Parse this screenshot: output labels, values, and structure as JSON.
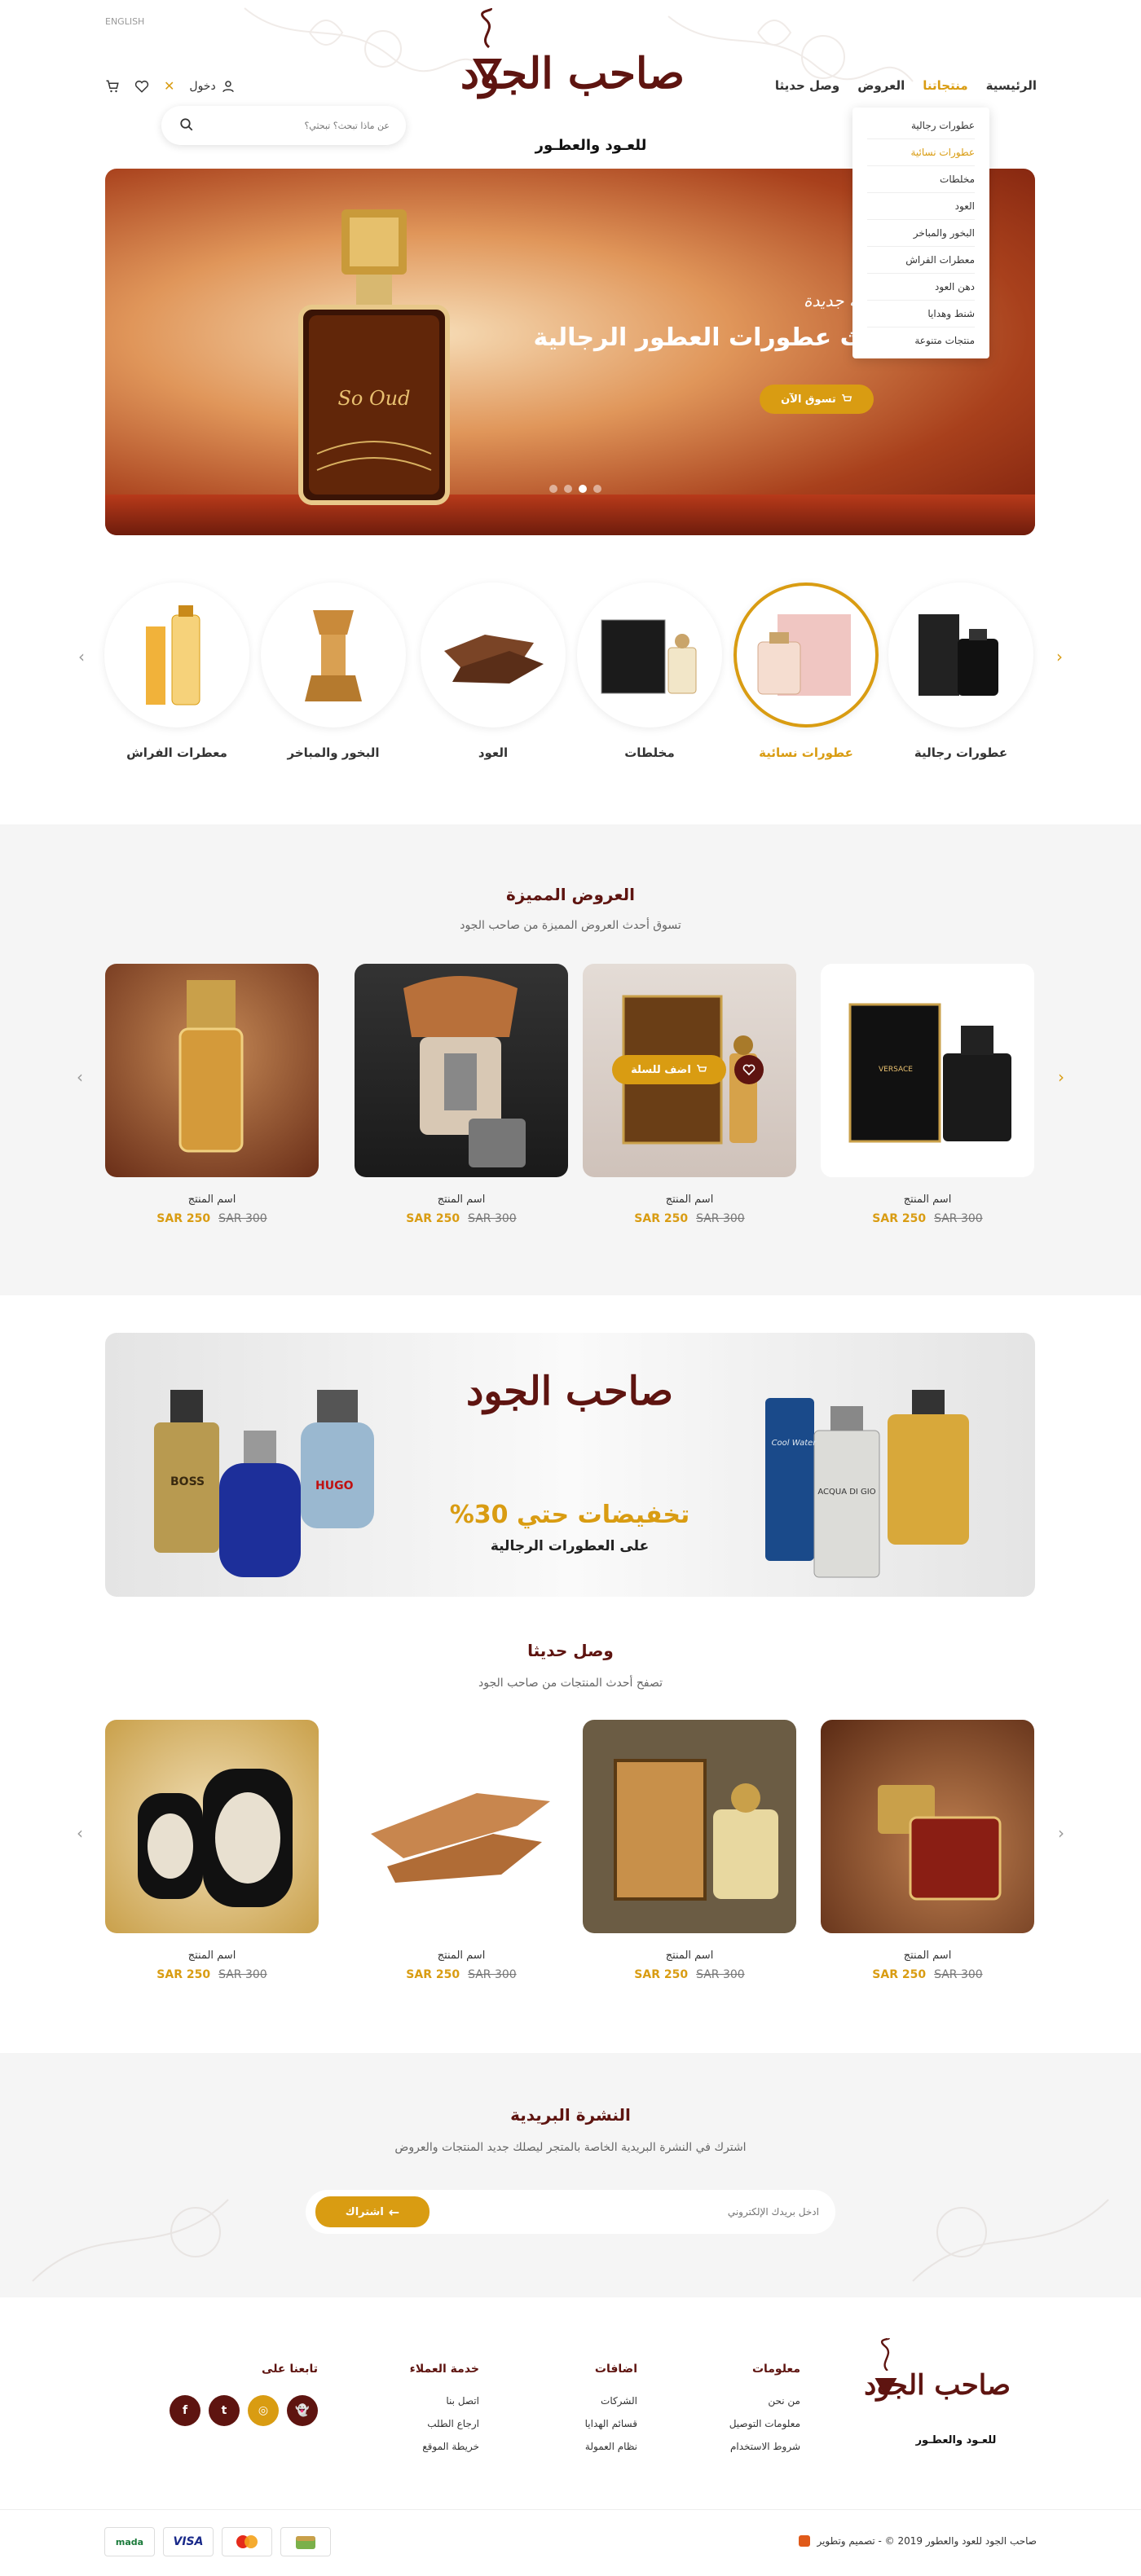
{
  "header": {
    "language": "ENGLISH",
    "login_label": "دخول",
    "logo_main": "صاحب الجود",
    "logo_sub": "للعـود والعطـور",
    "search_placeholder": "عن ماذا تبحث؟ تبحثي؟",
    "nav": [
      "الرئيسية",
      "منتجاتنا",
      "العروض",
      "وصل حديثا"
    ],
    "dropdown": [
      "عطورات رجالية",
      "عطورات نسائية",
      "مخلطات",
      "العود",
      "البخور والمباخر",
      "معطرات الفراش",
      "دهن العود",
      "شنط وهدايا",
      "منتجات متنوعة"
    ]
  },
  "hero": {
    "bottle_label": "So Oud",
    "eyebrow": "مجموعة جديدة",
    "title": "أحدث عطورات العطور الرجالية",
    "button": "تسوق الآن",
    "active_slide": 2,
    "slide_count": 4
  },
  "categories": [
    {
      "label": "عطورات رجالية",
      "active": false
    },
    {
      "label": "عطورات نسائية",
      "active": true
    },
    {
      "label": "مخلطات",
      "active": false
    },
    {
      "label": "العود",
      "active": false
    },
    {
      "label": "البخور والمباخر",
      "active": false
    },
    {
      "label": "معطرات الفراش",
      "active": false
    }
  ],
  "featured": {
    "title": "العروض المميزة",
    "subtitle": "تسوق أحدث العروض المميزة من صاحب الجود",
    "add_to_cart": "اضف للسلة",
    "products": [
      {
        "name": "اسم المنتج",
        "price": "SAR 250",
        "old_price": "SAR 300",
        "image_label": "VERSACE"
      },
      {
        "name": "اسم المنتج",
        "price": "SAR 250",
        "old_price": "SAR 300",
        "image_label": ""
      },
      {
        "name": "اسم المنتج",
        "price": "SAR 250",
        "old_price": "SAR 300",
        "image_label": ""
      },
      {
        "name": "اسم المنتج",
        "price": "SAR 250",
        "old_price": "SAR 300",
        "image_label": ""
      }
    ]
  },
  "banner": {
    "logo": "صاحب الجود",
    "headline": "تخفيضات حتي 30%",
    "subline": "على العطورات الرجالية",
    "left_labels": [
      "BOSS",
      "HUGO"
    ],
    "right_labels": [
      "Cool Water",
      "ACQUA DI GIO"
    ]
  },
  "new_arrivals": {
    "title": "وصل حديثا",
    "subtitle": "تصفح أحدث المنتجات من صاحب الجود",
    "products": [
      {
        "name": "اسم المنتج",
        "price": "SAR 250",
        "old_price": "SAR 300"
      },
      {
        "name": "اسم المنتج",
        "price": "SAR 250",
        "old_price": "SAR 300"
      },
      {
        "name": "اسم المنتج",
        "price": "SAR 250",
        "old_price": "SAR 300"
      },
      {
        "name": "اسم المنتج",
        "price": "SAR 250",
        "old_price": "SAR 300"
      }
    ]
  },
  "newsletter": {
    "title": "النشرة البريدية",
    "subtitle": "اشترك في النشرة البريدية الخاصة بالمتجر ليصلك جديد المنتجات والعروض",
    "placeholder": "ادخل بريدك الإلكتروني",
    "button": "اشتراك"
  },
  "footer": {
    "columns": [
      {
        "title": "معلومات",
        "links": [
          "من نحن",
          "معلومات التوصيل",
          "شروط الاستخدام"
        ]
      },
      {
        "title": "اضافات",
        "links": [
          "الشركات",
          "قسائم الهدايا",
          "نظام العمولة"
        ]
      },
      {
        "title": "خدمة العملاء",
        "links": [
          "اتصل بنا",
          "ارجاع الطلب",
          "خريطة الموقع"
        ]
      }
    ],
    "follow_title": "تابعنا على",
    "social": [
      "snapchat",
      "instagram",
      "twitter",
      "facebook"
    ],
    "copyright": "صاحب الجود للعود والعطور 2019 © - تصميم وتطوير",
    "payments": [
      "mada",
      "VISA",
      "mastercard",
      "wallet"
    ]
  },
  "colors": {
    "brand": "#5e1410",
    "accent": "#d99c12",
    "grey": "#f5f5f5"
  }
}
